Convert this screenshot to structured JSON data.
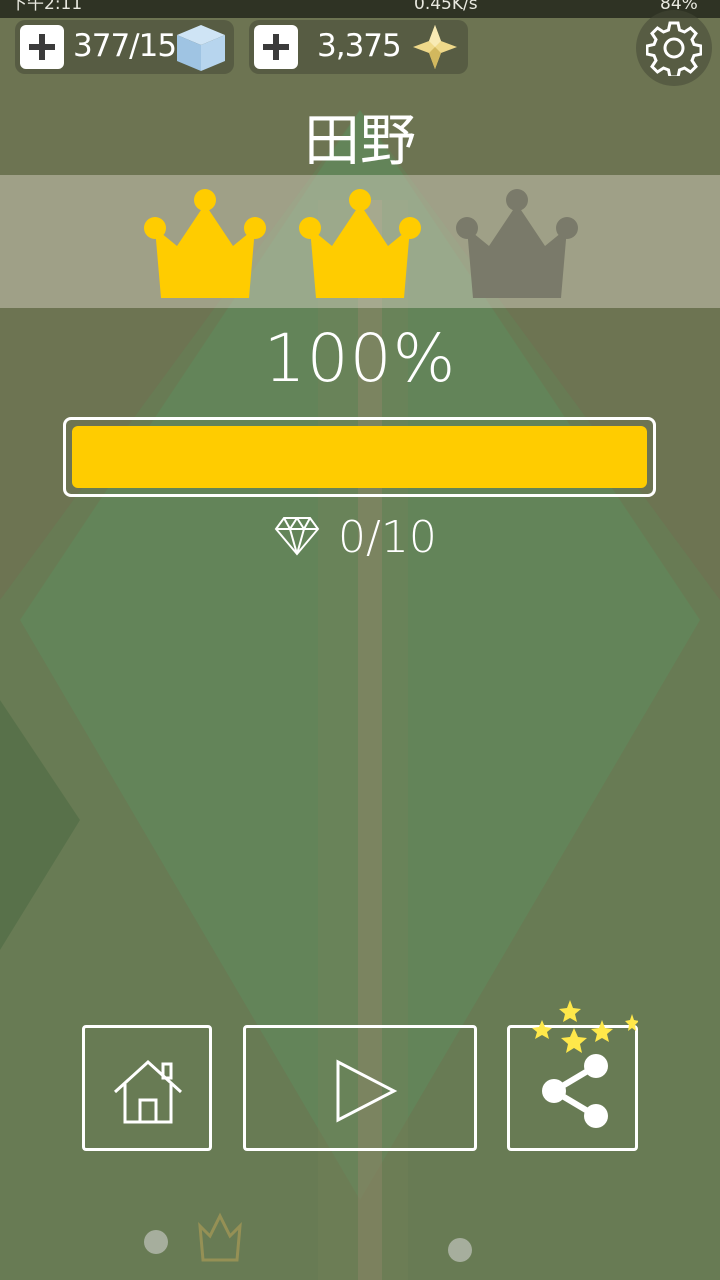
{
  "status_bar": {
    "time": "下午2:11",
    "network_speed": "0.45K/s",
    "battery": "84%"
  },
  "currency": {
    "cubes": "377/15",
    "gems": "3,375"
  },
  "level": {
    "title": "田野",
    "crowns_earned": 2,
    "crowns_total": 3,
    "percent_label": "100%",
    "progress_fraction": 1.0,
    "diamonds": "0/10"
  },
  "colors": {
    "accent_gold": "#ffcc00",
    "crown_inactive": "#7a7a6a",
    "background": "#6e7553"
  },
  "icons": [
    "plus-icon",
    "cube-icon",
    "gem-star-icon",
    "gear-icon",
    "crown-icon",
    "diamond-icon",
    "home-icon",
    "play-icon",
    "share-icon"
  ]
}
